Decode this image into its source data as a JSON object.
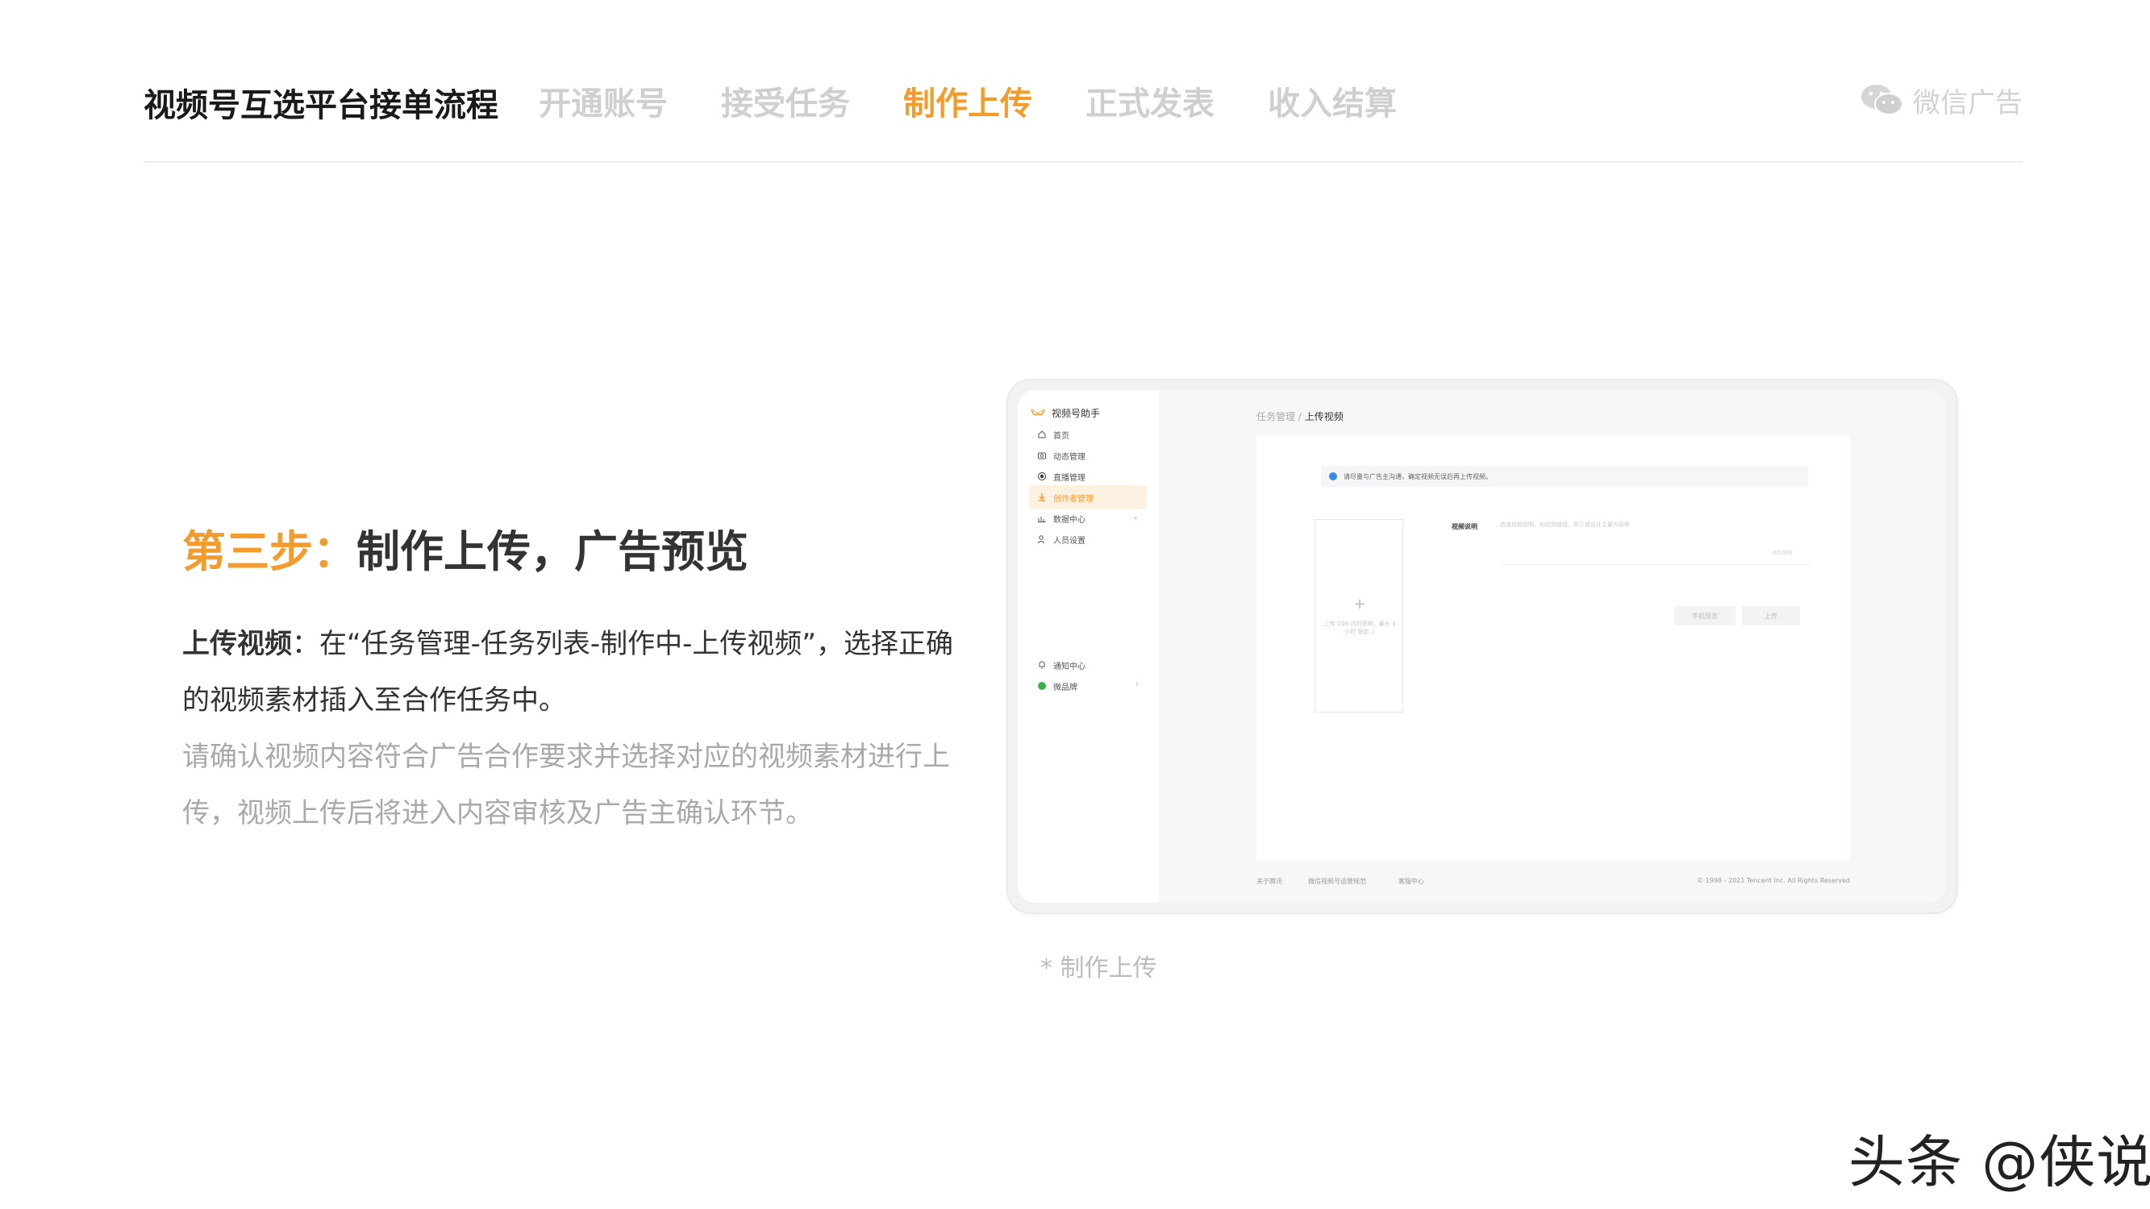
{
  "header": {
    "title": "视频号互选平台接单流程",
    "steps": [
      "开通账号",
      "接受任务",
      "制作上传",
      "正式发表",
      "收入结算"
    ],
    "active_step": "制作上传",
    "brand": "微信广告",
    "brand_icon": "wechat-icon"
  },
  "main": {
    "step_number": "第三步",
    "step_separator": "：",
    "step_title": "制作上传，广告预览",
    "desc_lead": "上传视频",
    "desc_text": "：在“任务管理-任务列表-制作中-上传视频”，选择正确的视频素材插入至合作任务中。",
    "desc_note": "请确认视频内容符合广告合作要求并选择对应的视频素材进行上传，视频上传后将进入内容审核及广告主确认环节。",
    "caption": "* 制作上传"
  },
  "mock_screen": {
    "app_name": "视频号助手",
    "sidebar": [
      {
        "label": "首页",
        "icon": "home-icon"
      },
      {
        "label": "动态管理",
        "icon": "camera-icon"
      },
      {
        "label": "直播管理",
        "icon": "live-icon"
      },
      {
        "label": "创作者管理",
        "icon": "creator-icon",
        "active": true
      },
      {
        "label": "数据中心",
        "icon": "chart-icon",
        "expandable": true
      },
      {
        "label": "人员设置",
        "icon": "people-icon"
      }
    ],
    "sidebar_bottom": [
      {
        "label": "通知中心",
        "icon": "bell-icon"
      },
      {
        "label": "微品牌",
        "icon": "brand-icon",
        "expandable": true
      }
    ],
    "breadcrumb_parent": "任务管理",
    "breadcrumb_sep": "/",
    "breadcrumb_current": "上传视频",
    "notice": "请尽量与广告主沟通，确定视频无误后再上传视频。",
    "upload_plus": "+",
    "upload_hint": "上传 1GB 内的视频，最长 1小时 限定 :)",
    "field_label": "视频说明",
    "field_placeholder": "选填视频说明，如视频链接、简介或设计主要内容等",
    "field_count": "0/1000",
    "btn_preview": "手机预览",
    "btn_upload": "上传",
    "footer": {
      "about": "关于腾讯",
      "rules": "微信视频号运营规范",
      "service": "客服中心",
      "copyright": "© 1998 - 2021 Tencent Inc. All Rights Reserved"
    }
  },
  "watermark": "头条 @侠说",
  "colors": {
    "accent": "#f39c2c",
    "nav_inactive": "#cfcfcf",
    "note_gray": "#a9a9a9"
  }
}
